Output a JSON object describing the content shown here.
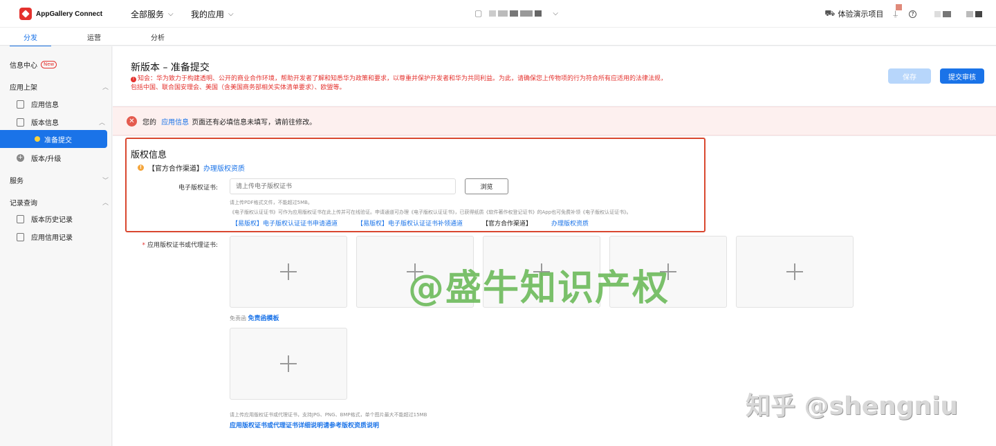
{
  "app": {
    "name": "AppGallery Connect"
  },
  "topnav": {
    "all_services": "全部服务",
    "my_apps": "我的应用"
  },
  "topright": {
    "demo_project": "体验演示项目"
  },
  "tabs": [
    {
      "label": "分发"
    },
    {
      "label": "运营"
    },
    {
      "label": "分析"
    }
  ],
  "sidebar": {
    "info_center": "信息中心",
    "new_badge": "New",
    "app_release": "应用上架",
    "app_info": "应用信息",
    "version_info": "版本信息",
    "prepare_submit": "准备提交",
    "version_upgrade": "版本/升级",
    "services": "服务",
    "records": "记录查询",
    "version_history": "版本历史记录",
    "credit_records": "应用信用记录"
  },
  "header": {
    "title": "新版本 – 准备提交",
    "notice": "知会：华为致力于构建透明、公开的商业合作环境，帮助开发者了解和知悉华为政策和要求，以尊重并保护开发者和华为共同利益。为此，请确保您上传物项的行为符合所有应适用的法律法规，包括中国、联合国安理会、美国（含美国商务部相关实体清单要求）、欧盟等。",
    "save_label": "保存",
    "submit_label": "提交审核"
  },
  "error_banner": {
    "prefix": "您的",
    "link": "应用信息",
    "suffix": "页面还有必填信息未填写，请前往修改。"
  },
  "copyright": {
    "title": "版权信息",
    "channel_prefix": "【官方合作渠道】",
    "channel_link": "办理版权资质",
    "ecert_label": "电子版权证书:",
    "ecert_placeholder": "请上传电子版权证书",
    "browse_label": "浏览",
    "hint1": "请上传PDF格式文件，不能超过5MB。",
    "hint2": "《电子版权认证证书》可作为应用版权证书在此上传并可在线验证。申请通道可办理《电子版权认证证书》，已获得纸质《软件著作权登记证书》的App也可免费补领《电子版权认证证书》。",
    "link1": "【易版权】电子版权认证证书申请通道",
    "link2": "【易版权】电子版权认证证书补领通道",
    "link3_prefix": "【官方合作渠道】",
    "link3": "办理版权资质",
    "cert_label": "应用版权证书或代理证书:",
    "free_prefix": "免责函",
    "free_link": "免责函模板",
    "upload_hint": "请上传应用版权证书或代理证书，支持JPG、PNG、BMP格式，单个图片最大不能超过15MB",
    "detail_link": "应用版权证书或代理证书详细说明请参考版权资质说明"
  },
  "watermarks": {
    "main": "@盛牛知识产权",
    "corner": "知乎 @shengniu"
  },
  "colors": {
    "accent": "#1a73e8",
    "danger": "#e4312d",
    "highlight_box": "#d9472f"
  }
}
